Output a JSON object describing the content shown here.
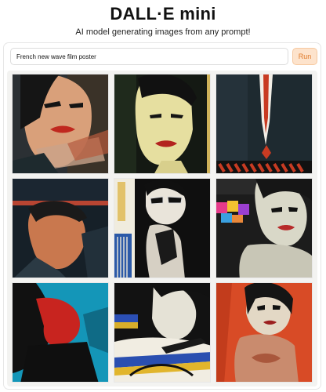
{
  "header": {
    "title": "DALL·E mini",
    "subtitle": "AI model generating images from any prompt!"
  },
  "prompt": {
    "value": "French new wave film poster",
    "run_label": "Run"
  },
  "results": {
    "count": 9,
    "images": [
      {
        "row": 1,
        "col": 1,
        "bg": "#2a2f33"
      },
      {
        "row": 1,
        "col": 2,
        "bg": "#151a14"
      },
      {
        "row": 1,
        "col": 3,
        "bg": "#1f2a2f"
      },
      {
        "row": 2,
        "col": 1,
        "bg": "#1a2530"
      },
      {
        "row": 2,
        "col": 2,
        "bg": "#101010"
      },
      {
        "row": 2,
        "col": 3,
        "bg": "#1b1b1b"
      },
      {
        "row": 3,
        "col": 1,
        "bg": "#1596b8"
      },
      {
        "row": 3,
        "col": 2,
        "bg": "#141414"
      },
      {
        "row": 3,
        "col": 3,
        "bg": "#d84b26"
      }
    ]
  },
  "colors": {
    "run_button_bg": "#fde3cc",
    "run_button_text": "#e07a2a",
    "grid_bg": "#f3f3f1"
  }
}
